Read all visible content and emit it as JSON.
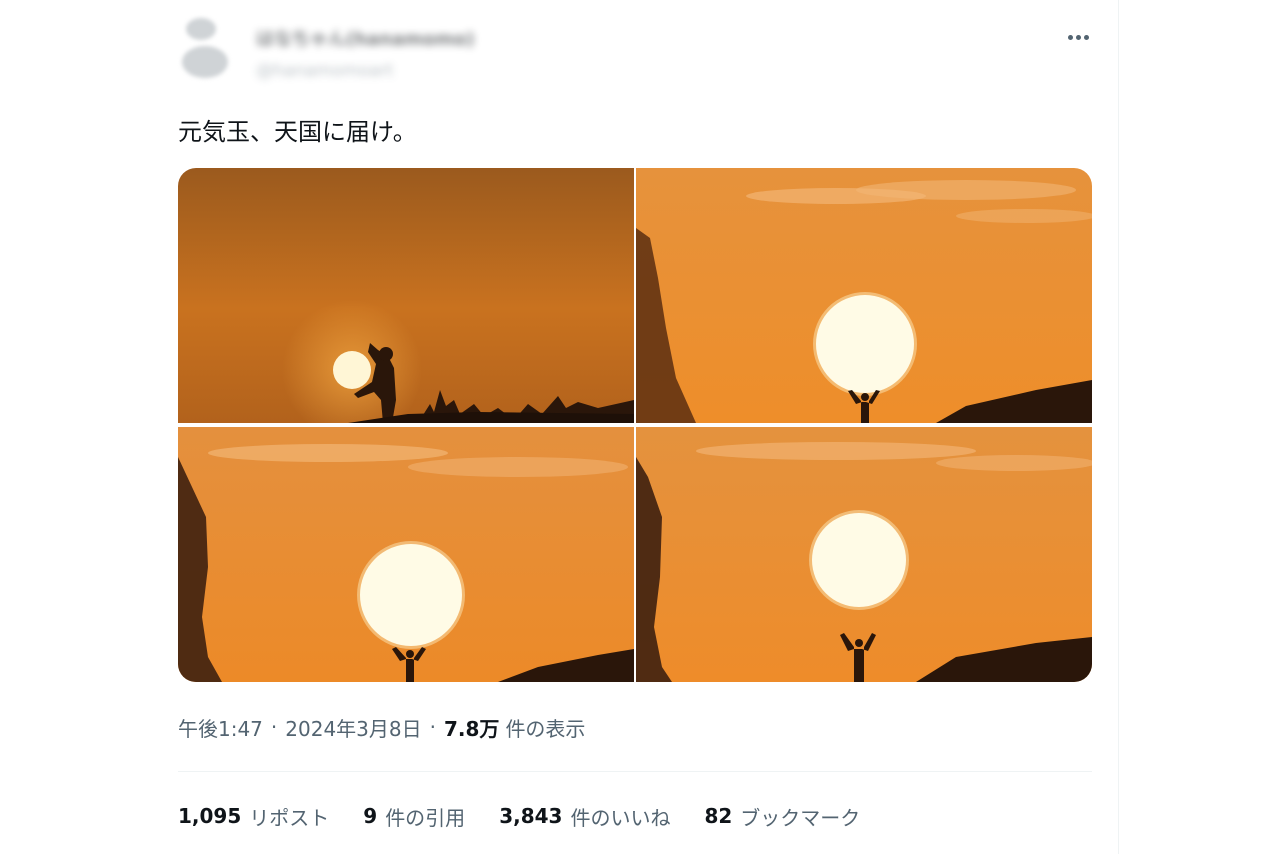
{
  "author": {
    "display_name": "はなちゃん(hanamomo)",
    "handle": "@hanamomoart"
  },
  "tweet": {
    "text": "元気玉、天国に届け。"
  },
  "meta": {
    "time": "午後1:47",
    "separator": "·",
    "date": "2024年3月8日",
    "views_count": "7.8万",
    "views_label": "件の表示"
  },
  "stats": [
    {
      "num": "1,095",
      "label": "リポスト"
    },
    {
      "num": "9",
      "label": "件の引用"
    },
    {
      "num": "3,843",
      "label": "件のいいね"
    },
    {
      "num": "82",
      "label": "ブックマーク"
    }
  ],
  "icons": {
    "more": "more-horizontal-icon"
  },
  "colors": {
    "sunset_orange": "#e8902a",
    "sun": "#fff4c8",
    "text_primary": "#0f1419",
    "text_secondary": "#536471"
  }
}
